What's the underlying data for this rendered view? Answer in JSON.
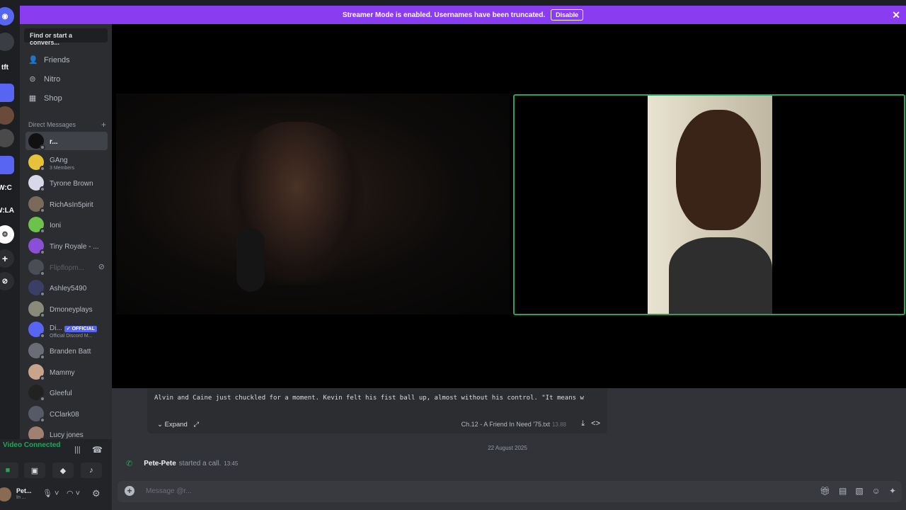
{
  "banner": {
    "text": "Streamer Mode is enabled. Usernames have been truncated.",
    "disable_label": "Disable",
    "close": "✕"
  },
  "guild_labels": [
    "tft",
    "W:C",
    "W:LA"
  ],
  "sidebar": {
    "search_placeholder": "Find or start a convers...",
    "nav": [
      {
        "label": "Friends",
        "icon": "friends-icon"
      },
      {
        "label": "Nitro",
        "icon": "nitro-icon"
      },
      {
        "label": "Shop",
        "icon": "shop-icon"
      }
    ],
    "dm_header": "Direct Messages",
    "dms": [
      {
        "name": "r...",
        "sub": "",
        "color": "#111111",
        "active": true
      },
      {
        "name": "GAng",
        "sub": "3 Members",
        "color": "#e8c13a"
      },
      {
        "name": "Tyrone Brown",
        "sub": "",
        "color": "#d8d8e8"
      },
      {
        "name": "RichAsIn5pirit",
        "sub": "",
        "color": "#7a6a5a"
      },
      {
        "name": "Ioni",
        "sub": "",
        "color": "#6cc24a"
      },
      {
        "name": "Tiny Royale - ...",
        "sub": "",
        "color": "#8a4fd6"
      },
      {
        "name": "Flipflopm...",
        "sub": "",
        "color": "#4a4d55",
        "muted": true
      },
      {
        "name": "Ashley5490",
        "sub": "",
        "color": "#3b3f66"
      },
      {
        "name": "Dmoneyplays",
        "sub": "",
        "color": "#8a8a7a"
      },
      {
        "name": "Di...",
        "sub": "Official Discord M...",
        "color": "#5865f2",
        "badge": "✓ OFFICIAL"
      },
      {
        "name": "Branden Batt",
        "sub": "",
        "color": "#6a6d75"
      },
      {
        "name": "Mammy",
        "sub": "",
        "color": "#c9a38a"
      },
      {
        "name": "Gleeful",
        "sub": "",
        "color": "#222222"
      },
      {
        "name": "CClark08",
        "sub": "",
        "color": "#555a66"
      },
      {
        "name": "Lucy jones",
        "sub": "",
        "color": "#a08070"
      }
    ]
  },
  "voice": {
    "status": "Video Connected",
    "user_name": "Pet...",
    "user_status": "In ..."
  },
  "chat": {
    "snippet": "Alvin and Caine just chuckled for a moment. Kevin felt his fist ball up, almost without his control. \"It means w",
    "expand_label": "Expand",
    "file_name": "Ch.12 - A Friend In Need '75.txt",
    "file_size": "13.88",
    "date_divider": "22 August 2025",
    "system_user": "Pete-Pete",
    "system_text": "started a call.",
    "system_time": "13:45"
  },
  "input": {
    "placeholder": "Message @r..."
  }
}
